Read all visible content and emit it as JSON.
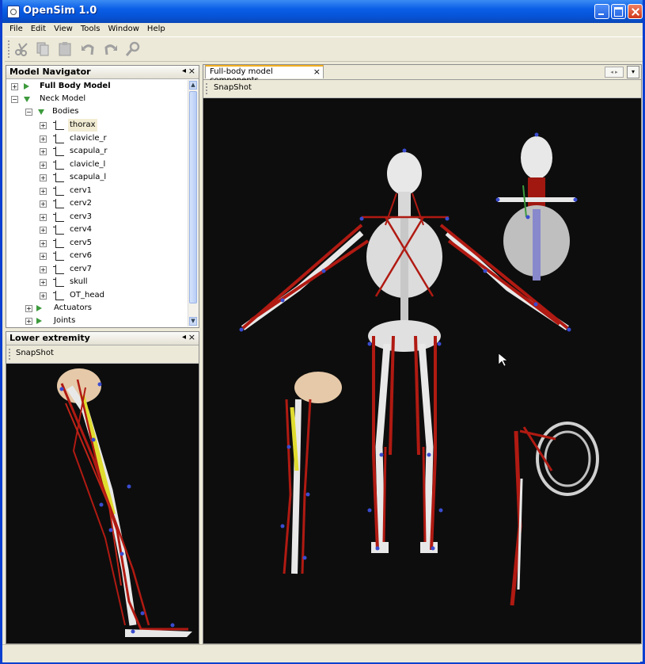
{
  "window": {
    "title": "OpenSim 1.0"
  },
  "menu": [
    "File",
    "Edit",
    "View",
    "Tools",
    "Window",
    "Help"
  ],
  "toolbar": {
    "icons": [
      "cut-icon",
      "copy-icon",
      "paste-icon",
      "undo-icon",
      "redo-icon",
      "find-icon"
    ]
  },
  "navigator": {
    "title": "Model Navigator",
    "pin": "◂",
    "close": "×",
    "models": [
      {
        "label": "Full Body Model",
        "bold": true
      },
      {
        "label": "Neck Model",
        "bold": false
      }
    ],
    "bodies_label": "Bodies",
    "bodies": [
      "thorax",
      "clavicle_r",
      "scapula_r",
      "clavicle_l",
      "scapula_l",
      "cerv1",
      "cerv2",
      "cerv3",
      "cerv4",
      "cerv5",
      "cerv6",
      "cerv7",
      "skull",
      "OT_head"
    ],
    "groups": [
      "Actuators",
      "Joints"
    ]
  },
  "lower": {
    "title": "Lower extremity",
    "snapshot": "SnapShot",
    "pin": "◂",
    "close": "×"
  },
  "main": {
    "tab_label": "Full-body model components",
    "tab_close": "×",
    "snapshot": "SnapShot",
    "nav": "◂ ▸",
    "drop": "▾"
  },
  "colors": {
    "accent": "#0a5ee6",
    "viewport": "#0d0d0d",
    "muscle": "#b01a12",
    "marker": "#3a4cd0",
    "bone": "#e8e8e8"
  }
}
